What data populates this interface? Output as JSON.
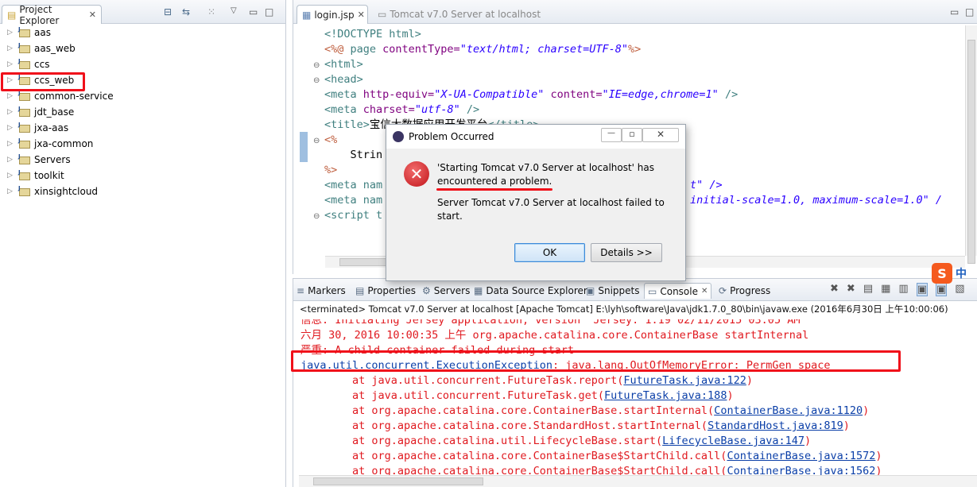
{
  "explorer": {
    "title": "Project Explorer",
    "items": [
      "aas",
      "aas_web",
      "ccs",
      "ccs_web",
      "common-service",
      "jdt_base",
      "jxa-aas",
      "jxa-common",
      "Servers",
      "toolkit",
      "xinsightcloud"
    ]
  },
  "editor": {
    "tabs": [
      "login.jsp",
      "Tomcat v7.0 Server at localhost"
    ],
    "lines": [
      [
        {
          "t": "<!DOCTYPE html>",
          "c": "kw"
        }
      ],
      [
        {
          "t": "<%@ ",
          "c": "pc"
        },
        {
          "t": "page ",
          "c": "kw"
        },
        {
          "t": "contentType=",
          "c": "at"
        },
        {
          "t": "\"text/html; charset=UTF-8\"",
          "c": "st"
        },
        {
          "t": "%>",
          "c": "pc"
        }
      ],
      [
        {
          "t": "<html>",
          "c": "kw"
        }
      ],
      [
        {
          "t": "<head>",
          "c": "kw"
        }
      ],
      [
        {
          "t": "<meta ",
          "c": "kw"
        },
        {
          "t": "http-equiv=",
          "c": "at"
        },
        {
          "t": "\"X-UA-Compatible\"",
          "c": "st"
        },
        {
          "t": " content=",
          "c": "at"
        },
        {
          "t": "\"IE=edge,chrome=1\"",
          "c": "st"
        },
        {
          "t": " />",
          "c": "kw"
        }
      ],
      [
        {
          "t": "<meta ",
          "c": "kw"
        },
        {
          "t": "charset=",
          "c": "at"
        },
        {
          "t": "\"utf-8\"",
          "c": "st"
        },
        {
          "t": " />",
          "c": "kw"
        }
      ],
      [
        {
          "t": "<title>",
          "c": "kw"
        },
        {
          "t": "宝信大数据应用开发平台",
          "c": "nm"
        },
        {
          "t": "</title>",
          "c": "kw"
        }
      ],
      [
        {
          "t": "<%",
          "c": "pc"
        }
      ],
      [
        {
          "t": "    Strin",
          "c": "nm"
        }
      ],
      [
        {
          "t": "%>",
          "c": "pc"
        }
      ],
      [
        {
          "t": "<meta nam",
          "c": "kw"
        }
      ],
      [
        {
          "t": "<meta nam",
          "c": "kw"
        }
      ],
      [
        {
          "t": "<script t",
          "c": "kw"
        }
      ]
    ],
    "frag1": "t\" />",
    "frag2": "initial-scale=1.0, maximum-scale=1.0\" /"
  },
  "dialog": {
    "title": "Problem Occurred",
    "message1": "'Starting Tomcat v7.0 Server at localhost' has encountered a problem.",
    "message2": "Server Tomcat v7.0 Server at localhost failed to start.",
    "ok": "OK",
    "details": "Details >>"
  },
  "console": {
    "tabs": [
      "Markers",
      "Properties",
      "Servers",
      "Data Source Explorer",
      "Snippets",
      "Console",
      "Progress"
    ],
    "status": "<terminated> Tomcat v7.0 Server at localhost [Apache Tomcat] E:\\lyh\\software\\Java\\jdk1.7.0_80\\bin\\javaw.exe (2016年6月30日 上午10:00:06)",
    "partial": "信息: Initiating Jersey application, version 'Jersey: 1.19 02/11/2015 03:05 AM'",
    "line2": "六月 30, 2016 10:00:35 上午 org.apache.catalina.core.ContainerBase startInternal",
    "line3": "严重: A child container failed during start",
    "exc_link": "java.util.concurrent.ExecutionException",
    "exc_rest": ": java.lang.OutOfMemoryError: PermGen space",
    "stack": [
      {
        "pre": "at java.util.concurrent.FutureTask.report(",
        "link": "FutureTask.java:122"
      },
      {
        "pre": "at java.util.concurrent.FutureTask.get(",
        "link": "FutureTask.java:188"
      },
      {
        "pre": "at org.apache.catalina.core.ContainerBase.startInternal(",
        "link": "ContainerBase.java:1120"
      },
      {
        "pre": "at org.apache.catalina.core.StandardHost.startInternal(",
        "link": "StandardHost.java:819"
      },
      {
        "pre": "at org.apache.catalina.util.LifecycleBase.start(",
        "link": "LifecycleBase.java:147"
      },
      {
        "pre": "at org.apache.catalina.core.ContainerBase$StartChild.call(",
        "link": "ContainerBase.java:1572"
      },
      {
        "pre": "at org.apache.catalina.core.ContainerBase$StartChild.call(",
        "link": "ContainerBase.java:1562"
      }
    ]
  },
  "ime": {
    "s": "S",
    "zh": "中"
  },
  "colors": {
    "red_highlight": "#f0101a",
    "error_text": "#e0191f",
    "link": "#0b3fa8"
  }
}
